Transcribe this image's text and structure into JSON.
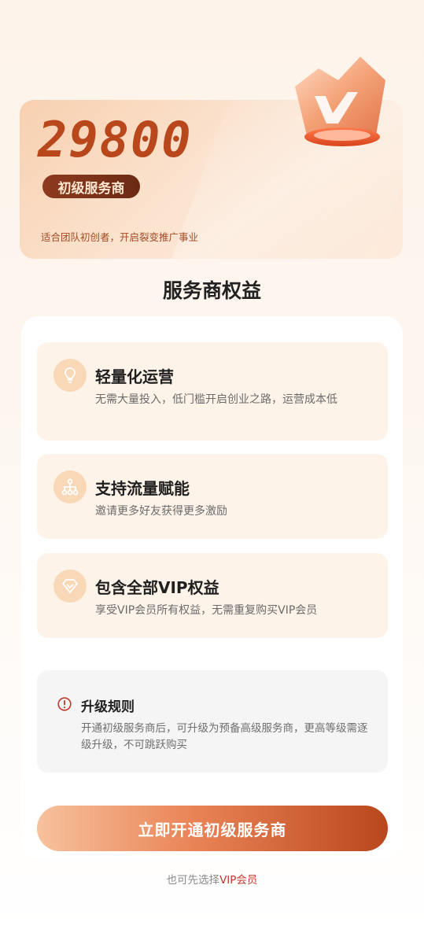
{
  "hero": {
    "price": "29800",
    "tier_label": "初级服务商",
    "description": "适合团队初创者，开启裂变推广事业"
  },
  "section": {
    "title": "服务商权益"
  },
  "benefits": [
    {
      "icon": "lightbulb-icon",
      "title": "轻量化运营",
      "desc": "无需大量投入，低门槛开启创业之路，运营成本低"
    },
    {
      "icon": "network-icon",
      "title": "支持流量赋能",
      "desc": "邀请更多好友获得更多激励"
    },
    {
      "icon": "diamond-icon",
      "title": "包含全部VIP权益",
      "desc": "享受VIP会员所有权益，无需重复购买VIP会员"
    }
  ],
  "rules": {
    "icon": "warning-icon",
    "title": "升级规则",
    "desc": "开通初级服务商后，可升级为预备高级服务商，更高等级需逐级升级，不可跳跃购买"
  },
  "cta": {
    "label": "立即开通初级服务商"
  },
  "alt": {
    "prefix": "也可先选择",
    "link": "VIP会员"
  },
  "colors": {
    "accent": "#b9471c",
    "badge_bg": "#6b2a14",
    "benefit_bg": "#fdf3e8",
    "link": "#c0392b"
  }
}
